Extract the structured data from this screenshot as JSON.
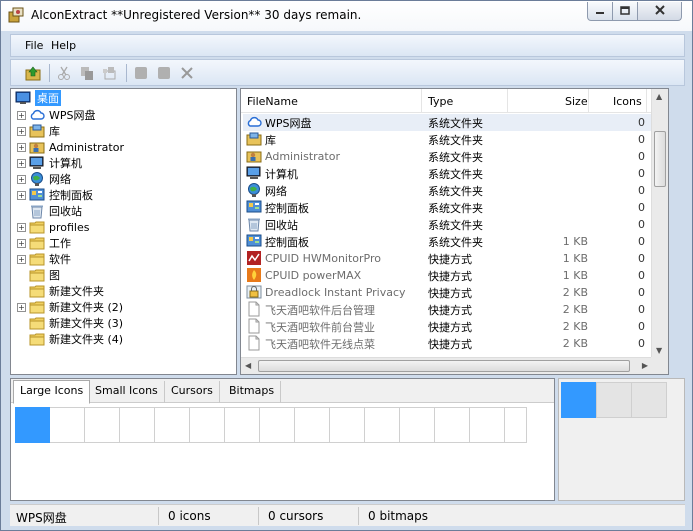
{
  "window": {
    "title": "AIconExtract  **Unregistered Version** 30 days remain."
  },
  "menu": [
    "File",
    "Help"
  ],
  "tree": {
    "root": "桌面",
    "items": [
      {
        "label": "WPS网盘",
        "icon": "cloud-icon",
        "expand": true
      },
      {
        "label": "库",
        "icon": "library-icon",
        "expand": true
      },
      {
        "label": "Administrator",
        "icon": "user-folder-icon",
        "expand": true
      },
      {
        "label": "计算机",
        "icon": "computer-icon",
        "expand": true
      },
      {
        "label": "网络",
        "icon": "network-icon",
        "expand": true
      },
      {
        "label": "控制面板",
        "icon": "control-panel-icon",
        "expand": true
      },
      {
        "label": "回收站",
        "icon": "recycle-bin-icon",
        "expand": false
      },
      {
        "label": "profiles",
        "icon": "folder-icon",
        "expand": true
      },
      {
        "label": "工作",
        "icon": "folder-icon",
        "expand": true
      },
      {
        "label": "软件",
        "icon": "folder-icon",
        "expand": true
      },
      {
        "label": "图",
        "icon": "folder-icon",
        "expand": false
      },
      {
        "label": "新建文件夹",
        "icon": "folder-icon",
        "expand": false
      },
      {
        "label": "新建文件夹 (2)",
        "icon": "folder-icon",
        "expand": true
      },
      {
        "label": "新建文件夹 (3)",
        "icon": "folder-icon",
        "expand": false
      },
      {
        "label": "新建文件夹 (4)",
        "icon": "folder-icon",
        "expand": false
      }
    ]
  },
  "list": {
    "columns": {
      "filename": "FileName",
      "type": "Type",
      "size": "Size",
      "icons": "Icons"
    },
    "rows": [
      {
        "name": "WPS网盘",
        "type": "系统文件夹",
        "size": "",
        "icons": "0",
        "icon": "cloud-icon"
      },
      {
        "name": "库",
        "type": "系统文件夹",
        "size": "",
        "icons": "0",
        "icon": "library-icon"
      },
      {
        "name": "Administrator",
        "type": "系统文件夹",
        "size": "",
        "icons": "0",
        "icon": "user-folder-icon"
      },
      {
        "name": "计算机",
        "type": "系统文件夹",
        "size": "",
        "icons": "0",
        "icon": "computer-icon"
      },
      {
        "name": "网络",
        "type": "系统文件夹",
        "size": "",
        "icons": "0",
        "icon": "network-icon"
      },
      {
        "name": "控制面板",
        "type": "系统文件夹",
        "size": "",
        "icons": "0",
        "icon": "control-panel-icon"
      },
      {
        "name": "回收站",
        "type": "系统文件夹",
        "size": "",
        "icons": "0",
        "icon": "recycle-bin-icon"
      },
      {
        "name": "控制面板",
        "type": "系统文件夹",
        "size": "1 KB",
        "icons": "0",
        "icon": "control-panel-icon"
      },
      {
        "name": "CPUID HWMonitorPro",
        "type": "快捷方式",
        "size": "1 KB",
        "icons": "0",
        "icon": "hwmonitor-icon"
      },
      {
        "name": "CPUID powerMAX",
        "type": "快捷方式",
        "size": "1 KB",
        "icons": "0",
        "icon": "powermax-icon"
      },
      {
        "name": "Dreadlock Instant Privacy",
        "type": "快捷方式",
        "size": "2 KB",
        "icons": "0",
        "icon": "dreadlock-icon"
      },
      {
        "name": "飞天酒吧软件后台管理",
        "type": "快捷方式",
        "size": "2 KB",
        "icons": "0",
        "icon": "document-icon"
      },
      {
        "name": "飞天酒吧软件前台营业",
        "type": "快捷方式",
        "size": "2 KB",
        "icons": "0",
        "icon": "document-icon"
      },
      {
        "name": "飞天酒吧软件无线点菜",
        "type": "快捷方式",
        "size": "2 KB",
        "icons": "0",
        "icon": "document-icon"
      }
    ]
  },
  "tabs": [
    "Large Icons",
    "Small Icons",
    "Cursors",
    "Bitmaps"
  ],
  "status": {
    "file": "WPS网盘",
    "icons": "0 icons",
    "cursors": "0 cursors",
    "bitmaps": "0 bitmaps"
  },
  "colors": {
    "selection": "#3399ff",
    "chrome": "#cfdcec"
  }
}
